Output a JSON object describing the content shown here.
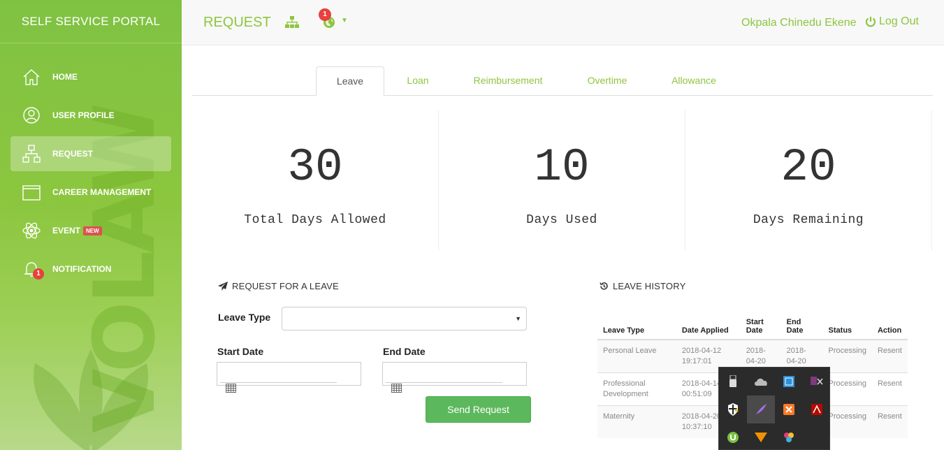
{
  "sidebar": {
    "brand": "SELF SERVICE PORTAL",
    "watermark": "VOLAW",
    "items": [
      {
        "label": "HOME",
        "icon": "home-icon"
      },
      {
        "label": "USER PROFILE",
        "icon": "user-circle-icon"
      },
      {
        "label": "REQUEST",
        "icon": "sitemap-icon",
        "active": true
      },
      {
        "label": "CAREER MANAGEMENT",
        "icon": "folder-icon"
      },
      {
        "label": "EVENT",
        "icon": "atom-icon",
        "badge": "NEW"
      },
      {
        "label": "NOTIFICATION",
        "icon": "bell-icon",
        "count": "1"
      }
    ]
  },
  "header": {
    "title": "REQUEST",
    "globe_badge": "1",
    "user_name": "Okpala Chinedu Ekene",
    "logout_label": "Log Out"
  },
  "tabs": [
    {
      "label": "Leave",
      "active": true
    },
    {
      "label": "Loan"
    },
    {
      "label": "Reimbursement"
    },
    {
      "label": "Overtime"
    },
    {
      "label": "Allowance"
    }
  ],
  "stats": [
    {
      "value": "30",
      "label": "Total Days Allowed"
    },
    {
      "value": "10",
      "label": "Days Used"
    },
    {
      "value": "20",
      "label": "Days Remaining"
    }
  ],
  "request_form": {
    "title": "REQUEST FOR A LEAVE",
    "leave_type_label": "Leave Type",
    "leave_type_value": "",
    "start_date_label": "Start Date",
    "start_date_value": "",
    "end_date_label": "End Date",
    "end_date_value": "",
    "submit_label": "Send Request"
  },
  "history": {
    "title": "LEAVE HISTORY",
    "columns": [
      "Leave Type",
      "Date Applied",
      "Start Date",
      "End Date",
      "Status",
      "Action"
    ],
    "rows": [
      {
        "leave_type": "Personal Leave",
        "date_applied": "2018-04-12 19:17:01",
        "start_date": "2018-04-20",
        "end_date": "2018-04-20",
        "status": "Processing",
        "action": "Resent"
      },
      {
        "leave_type": "Professional Development",
        "date_applied": "2018-04-14 00:51:09",
        "start_date": "",
        "end_date": "",
        "status": "Processing",
        "action": "Resent"
      },
      {
        "leave_type": "Maternity",
        "date_applied": "2018-04-20 10:37:10",
        "start_date": "",
        "end_date": "",
        "status": "Processing",
        "action": "Resent"
      }
    ]
  },
  "tray_icons": [
    "usb-icon",
    "onedrive-icon",
    "network-icon",
    "onenote-clip-icon",
    "shield-warning-icon",
    "feather-icon",
    "xampp-icon",
    "adobe-icon",
    "utorrent-icon",
    "vlc-icon",
    "color-picker-icon"
  ],
  "colors": {
    "accent": "#8cc63f",
    "button": "#5cb85c",
    "badge": "#e8413e"
  }
}
